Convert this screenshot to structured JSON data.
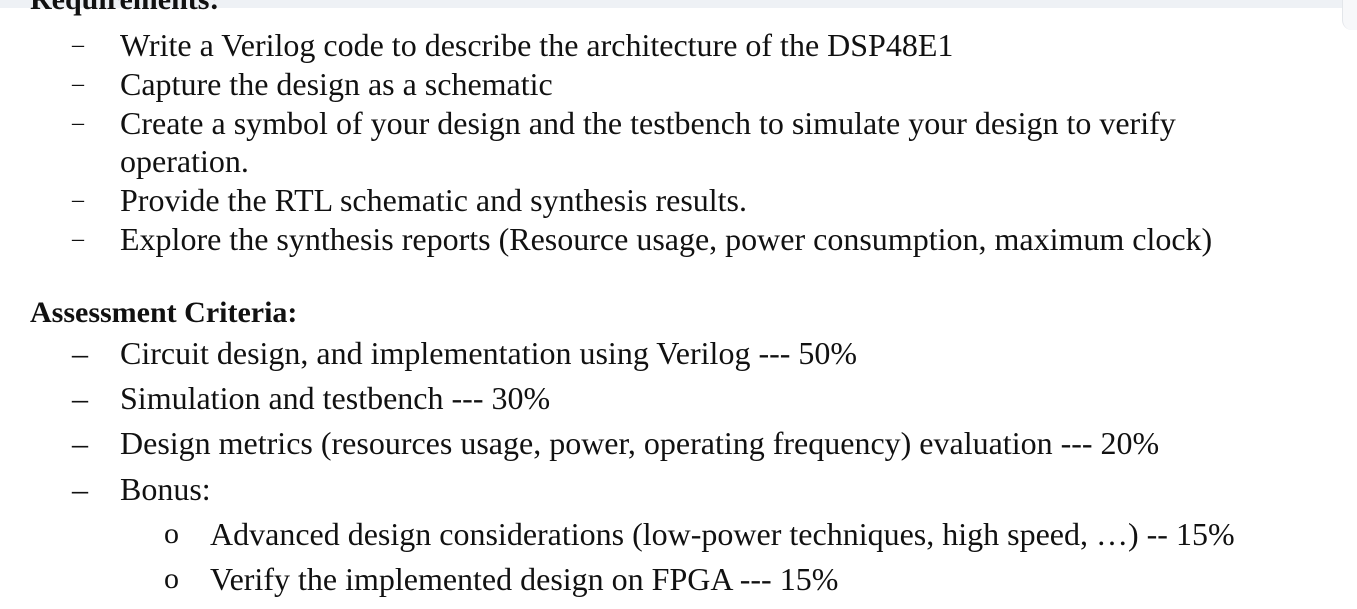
{
  "requirements": {
    "heading": "Requirements:",
    "items": [
      "Write a Verilog code to describe the architecture of the DSP48E1",
      "Capture the design as a schematic",
      "Create a symbol of your design and the testbench to simulate your design to verify",
      "operation.",
      "Provide the RTL schematic and synthesis results.",
      "Explore the synthesis reports (Resource usage, power consumption, maximum clock)"
    ]
  },
  "assessment": {
    "heading": "Assessment Criteria:",
    "items": [
      "Circuit design, and implementation using Verilog --- 50%",
      "Simulation and testbench --- 30%",
      "Design metrics (resources usage, power, operating frequency) evaluation --- 20%",
      "Bonus:"
    ],
    "bonus_items": [
      "Advanced design considerations (low-power techniques, high speed, …) -- 15%",
      "Verify the implemented design on FPGA --- 15%"
    ]
  },
  "markers": {
    "dash": "–",
    "bullet": "o"
  }
}
